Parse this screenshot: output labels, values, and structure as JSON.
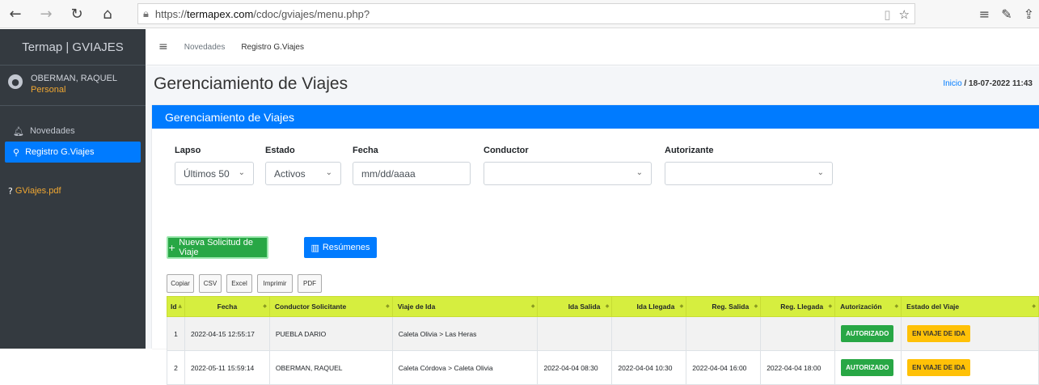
{
  "browser": {
    "url_prefix": "https://",
    "url_host": "termapex.com",
    "url_path": "/cdoc/gviajes/menu.php?"
  },
  "sidebar": {
    "brand": "Termap | GVIAJES",
    "user_name": "OBERMAN, RAQUEL",
    "user_role": "Personal",
    "items": [
      {
        "label": "Novedades",
        "icon": "bell-icon"
      },
      {
        "label": "Registro G.Viajes",
        "icon": "route-icon"
      }
    ],
    "pdf_link": "GViajes.pdf"
  },
  "topnav": {
    "link1": "Novedades",
    "link2": "Registro G.Viajes"
  },
  "page": {
    "title": "Gerenciamiento de Viajes",
    "breadcrumb_home": "Inicio",
    "breadcrumb_sep": " / ",
    "breadcrumb_date": "18-07-2022 11:43"
  },
  "card": {
    "header": "Gerenciamiento de Viajes"
  },
  "filters": {
    "lapso_label": "Lapso",
    "lapso_value": "Últimos 50",
    "estado_label": "Estado",
    "estado_value": "Activos",
    "fecha_label": "Fecha",
    "fecha_placeholder": "mm/dd/aaaa",
    "conductor_label": "Conductor",
    "conductor_value": "",
    "autorizante_label": "Autorizante",
    "autorizante_value": ""
  },
  "actions": {
    "new_label": "Nueva Solicitud de Viaje",
    "summary_label": "Resúmenes"
  },
  "export": [
    "Copiar",
    "CSV",
    "Excel",
    "Imprimir",
    "PDF"
  ],
  "table": {
    "headers": [
      "Id",
      "Fecha",
      "Conductor Solicitante",
      "Viaje de Ida",
      "Ida Salida",
      "Ida Llegada",
      "Reg. Salida",
      "Reg. Llegada",
      "Autorización",
      "Estado del Viaje"
    ],
    "rows": [
      {
        "id": "1",
        "fecha": "2022-04-15 12:55:17",
        "conductor": "PUEBLA DARIO",
        "viaje": "Caleta Olivia > Las Heras",
        "ida_salida": "",
        "ida_llegada": "",
        "reg_salida": "",
        "reg_llegada": "",
        "autorizacion": "AUTORIZADO",
        "estado": "EN VIAJE DE IDA"
      },
      {
        "id": "2",
        "fecha": "2022-05-11 15:59:14",
        "conductor": "OBERMAN, RAQUEL",
        "viaje": "Caleta Córdova > Caleta Olivia",
        "ida_salida": "2022-04-04 08:30",
        "ida_llegada": "2022-04-04 10:30",
        "reg_salida": "2022-04-04 16:00",
        "reg_llegada": "2022-04-04 18:00",
        "autorizacion": "AUTORIZADO",
        "estado": "EN VIAJE DE IDA"
      }
    ]
  },
  "colors": {
    "primary": "#007bff",
    "success": "#28a745",
    "warning": "#ffc107",
    "table_header": "#d6ee3f",
    "sidebar": "#343a40"
  }
}
